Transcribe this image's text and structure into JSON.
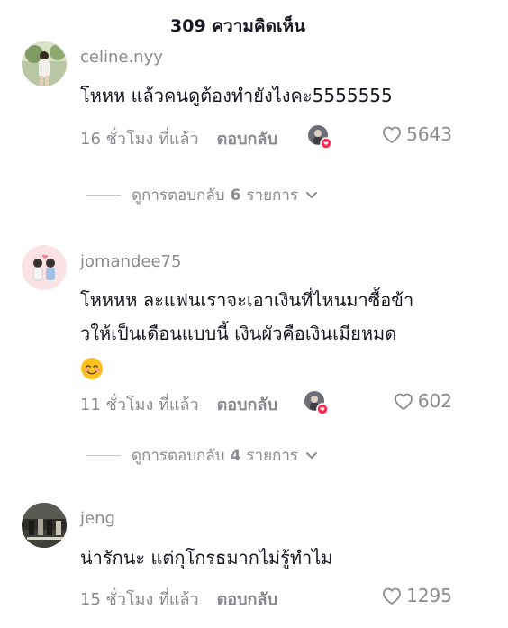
{
  "header": {
    "title": "309 ความคิดเห็น"
  },
  "comments": [
    {
      "username": "celine.nyy",
      "text": "โหหห แล้วคนดูต้องทำยังไงคะ5555555",
      "time": "16 ชั่วโมง ที่แล้ว",
      "reply_label": "ตอบกลับ",
      "creator_liked": true,
      "likes": "5643",
      "replies": {
        "prefix": "ดูการตอบกลับ",
        "count": "6",
        "suffix": "รายการ"
      }
    },
    {
      "username": "jomandee75",
      "text_line1": "โหหหห ละแฟนเราจะเอาเงินที่ไหนมาซื้อข้า",
      "text_line2": "วให้เป็นเดือนแบบนี้ เงินผัวคือเงินเมียหมด",
      "emoji": "smiling-face-emoji",
      "time": "11 ชั่วโมง ที่แล้ว",
      "reply_label": "ตอบกลับ",
      "creator_liked": true,
      "likes": "602",
      "replies": {
        "prefix": "ดูการตอบกลับ",
        "count": "4",
        "suffix": "รายการ"
      }
    },
    {
      "username": "jeng",
      "text": "น่ารักนะ แต่กุโกรธมากไม่รู้ทำไม",
      "time": "15 ชั่วโมง ที่แล้ว",
      "reply_label": "ตอบกลับ",
      "creator_liked": false,
      "likes": "1295"
    }
  ],
  "colors": {
    "text_primary": "#161823",
    "text_secondary": "#8a8b91",
    "like_badge": "#fe2c55"
  }
}
